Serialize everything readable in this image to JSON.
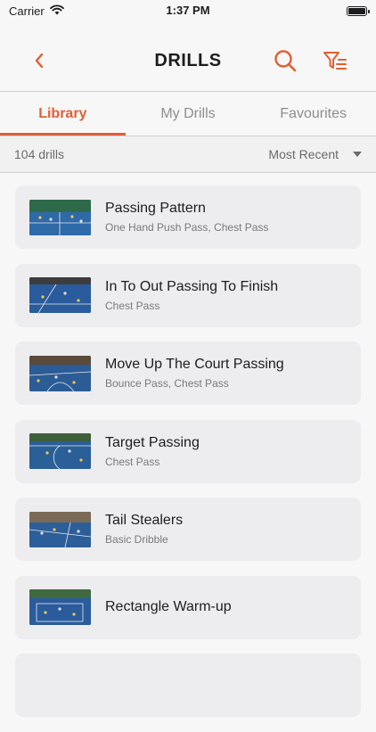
{
  "status": {
    "carrier": "Carrier",
    "time": "1:37 PM"
  },
  "header": {
    "title": "DRILLS"
  },
  "tabs": [
    {
      "label": "Library",
      "active": true
    },
    {
      "label": "My Drills",
      "active": false
    },
    {
      "label": "Favourites",
      "active": false
    }
  ],
  "sort": {
    "count": "104 drills",
    "order": "Most Recent"
  },
  "drills": [
    {
      "title": "Passing Pattern",
      "skills": "One Hand Push Pass, Chest Pass"
    },
    {
      "title": "In To Out Passing To Finish",
      "skills": "Chest Pass"
    },
    {
      "title": "Move Up The Court Passing",
      "skills": "Bounce Pass, Chest Pass"
    },
    {
      "title": "Target Passing",
      "skills": "Chest Pass"
    },
    {
      "title": "Tail Stealers",
      "skills": "Basic Dribble"
    },
    {
      "title": "Rectangle Warm-up",
      "skills": ""
    }
  ],
  "colors": {
    "accent": "#e06035",
    "court": "#2a5b9c"
  },
  "icons": [
    "back-chevron-icon",
    "search-icon",
    "filter-icon",
    "wifi-icon",
    "battery-icon",
    "caret-down-icon"
  ]
}
